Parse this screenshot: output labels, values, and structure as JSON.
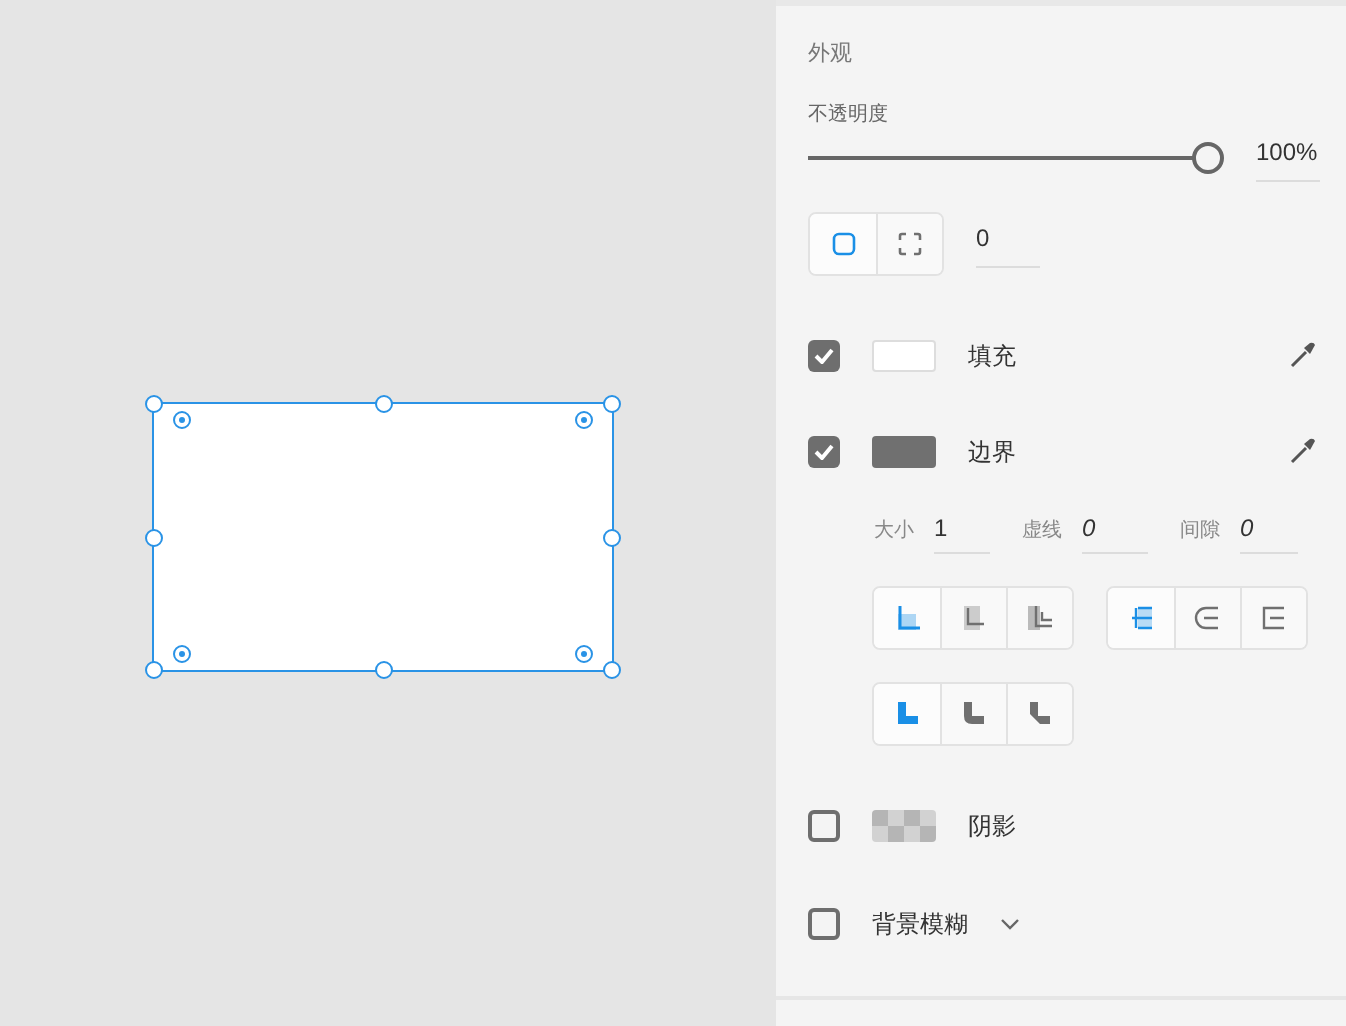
{
  "canvas": {
    "shape": {
      "selected": true
    }
  },
  "appearance": {
    "title": "外观",
    "opacity": {
      "label": "不透明度",
      "level": 1,
      "value": "100%"
    },
    "corner_modes": [
      {
        "selected": true
      },
      {
        "selected": false
      }
    ],
    "corner_radius": "0"
  },
  "fill": {
    "label": "填充",
    "checked": true,
    "color": "#ffffff"
  },
  "border": {
    "label": "边界",
    "checked": true,
    "color": "#707070",
    "size": {
      "label": "大小",
      "value": "1"
    },
    "dash": {
      "label": "虚线",
      "value": "0"
    },
    "gap": {
      "label": "间隙",
      "value": "0"
    },
    "stroke_position": [
      {
        "selected": true
      },
      {
        "selected": false
      },
      {
        "selected": false
      }
    ],
    "stroke_cap": [
      {
        "selected": true
      },
      {
        "selected": false
      },
      {
        "selected": false
      }
    ],
    "stroke_join": [
      {
        "selected": true
      },
      {
        "selected": false
      },
      {
        "selected": false
      }
    ]
  },
  "shadow": {
    "label": "阴影",
    "checked": false
  },
  "background_blur": {
    "label": "背景模糊",
    "checked": false
  }
}
